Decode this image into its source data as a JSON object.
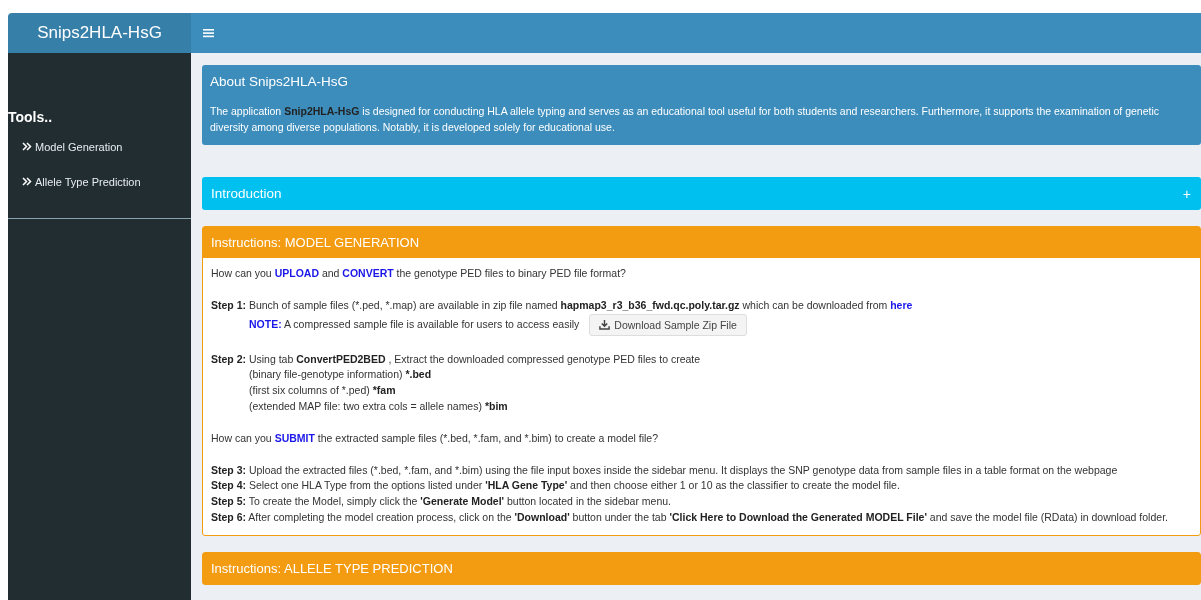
{
  "header": {
    "title": "Snips2HLA-HsG"
  },
  "sidebar": {
    "heading": "Tools..",
    "items": [
      {
        "label": "Model Generation",
        "selected": false
      },
      {
        "label": "Allele Type Prediction",
        "selected": false
      }
    ]
  },
  "boxes": [
    {
      "kind": "solid",
      "color": "#3c8dbc",
      "title": "About Snips2HLA-HsG",
      "paragraphs": [
        {
          "segments": [
            {
              "kind": "text",
              "text": "The application "
            },
            {
              "kind": "bold",
              "text": "Snip2HLA-HsG"
            },
            {
              "kind": "text",
              "text": " is designed for conducting HLA allele typing and serves as an educational tool useful for both students and researchers. Furthermore, it supports the examination of genetic diversity among diverse populations. Notably, it is developed solely for educational use."
            }
          ]
        }
      ]
    },
    {
      "kind": "collapsed",
      "color": "#00c0ef",
      "title": "Introduction",
      "toggle": "+"
    },
    {
      "kind": "outlined",
      "color": "#f39c12",
      "title": "Instructions: MODEL GENERATION",
      "paragraphs": [
        {
          "segments": [
            {
              "kind": "text",
              "text": "How can you "
            },
            {
              "kind": "accent",
              "text": "UPLOAD"
            },
            {
              "kind": "text",
              "text": " and "
            },
            {
              "kind": "accent",
              "text": "CONVERT"
            },
            {
              "kind": "text",
              "text": " the genotype PED files to binary PED file format?"
            }
          ]
        },
        {
          "gap": true,
          "segments": [
            {
              "kind": "bold",
              "text": "Step 1:"
            },
            {
              "kind": "text",
              "text": " Bunch of sample files (*.ped, *.map) are available in zip file named "
            },
            {
              "kind": "bold",
              "text": "hapmap3_r3_b36_fwd.qc.poly.tar.gz"
            },
            {
              "kind": "text",
              "text": " which can be downloaded from "
            },
            {
              "kind": "link",
              "text": "here"
            }
          ]
        },
        {
          "indent": true,
          "button": "Download Sample Zip File",
          "segments": [
            {
              "kind": "accent",
              "text": "NOTE:"
            },
            {
              "kind": "text",
              "text": " A compressed sample file is available for users to access easily"
            }
          ]
        },
        {
          "gap": true,
          "segments": [
            {
              "kind": "bold",
              "text": "Step 2:"
            },
            {
              "kind": "text",
              "text": " Using tab "
            },
            {
              "kind": "bold",
              "text": "ConvertPED2BED"
            },
            {
              "kind": "text",
              "text": " , Extract the downloaded compressed genotype PED files to create"
            }
          ]
        },
        {
          "indent": true,
          "segments": [
            {
              "kind": "text",
              "text": "(binary file-genotype information) "
            },
            {
              "kind": "bold",
              "text": "*.bed"
            }
          ]
        },
        {
          "indent": true,
          "segments": [
            {
              "kind": "text",
              "text": "(first six columns of *.ped) "
            },
            {
              "kind": "bold",
              "text": "*fam"
            }
          ]
        },
        {
          "indent": true,
          "segments": [
            {
              "kind": "text",
              "text": "(extended MAP file: two extra cols = allele names) "
            },
            {
              "kind": "bold",
              "text": "*bim"
            }
          ]
        },
        {
          "gap": true,
          "segments": [
            {
              "kind": "text",
              "text": "How can you "
            },
            {
              "kind": "accent",
              "text": "SUBMIT"
            },
            {
              "kind": "text",
              "text": " the extracted sample files (*.bed, *.fam, and *.bim) to create a model file?"
            }
          ]
        },
        {
          "gap": true,
          "segments": [
            {
              "kind": "bold",
              "text": "Step 3:"
            },
            {
              "kind": "text",
              "text": " Upload the extracted files (*.bed, *.fam, and *.bim) using the file input boxes inside the sidebar menu. It displays the SNP genotype data from sample files in a table format on the webpage"
            }
          ]
        },
        {
          "segments": [
            {
              "kind": "bold",
              "text": "Step 4:"
            },
            {
              "kind": "text",
              "text": " Select one HLA Type from the options listed under "
            },
            {
              "kind": "bold",
              "text": "'HLA Gene Type'"
            },
            {
              "kind": "text",
              "text": " and then choose either 1 or 10 as the classifier to create the model file."
            }
          ]
        },
        {
          "segments": [
            {
              "kind": "bold",
              "text": "Step 5:"
            },
            {
              "kind": "text",
              "text": " To create the Model, simply click the "
            },
            {
              "kind": "bold",
              "text": "'Generate Model'"
            },
            {
              "kind": "text",
              "text": " button located in the sidebar menu."
            }
          ]
        },
        {
          "segments": [
            {
              "kind": "bold",
              "text": "Step 6:"
            },
            {
              "kind": "text",
              "text": " After completing the model creation process, click on the "
            },
            {
              "kind": "bold",
              "text": "'Download'"
            },
            {
              "kind": "text",
              "text": " button under the tab "
            },
            {
              "kind": "bold",
              "text": "'Click Here to Download the Generated MODEL File'"
            },
            {
              "kind": "text",
              "text": " and save the model file (RData) in download folder."
            }
          ]
        }
      ]
    },
    {
      "kind": "outlined",
      "color": "#f39c12",
      "title": "Instructions: ALLELE TYPE PREDICTION"
    }
  ]
}
